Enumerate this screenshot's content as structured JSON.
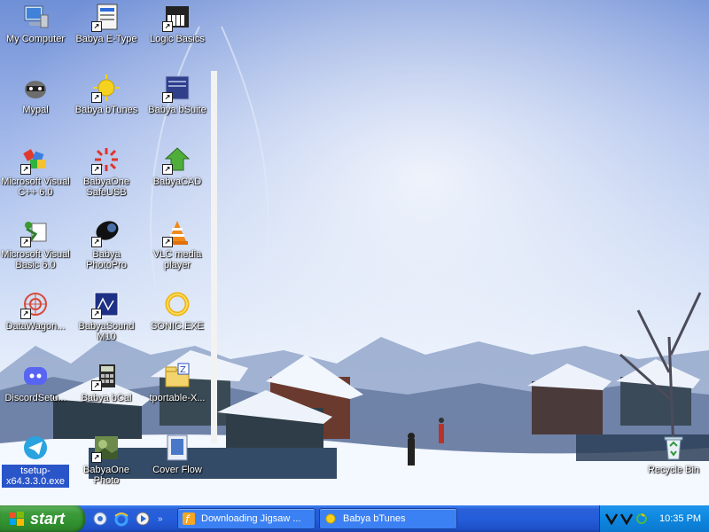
{
  "desktop": {
    "icons": [
      {
        "label": "My Computer"
      },
      {
        "label": "Babya E-Type"
      },
      {
        "label": "Logic Basics"
      },
      {
        "label": "Mypal"
      },
      {
        "label": "Babya bTunes"
      },
      {
        "label": "Babya bSuite"
      },
      {
        "label": "Microsoft Visual C++ 6.0"
      },
      {
        "label": "BabyaOne SafeUSB"
      },
      {
        "label": "BabyaCAD"
      },
      {
        "label": "Microsoft Visual Basic 6.0"
      },
      {
        "label": "Babya PhotoPro"
      },
      {
        "label": "VLC media player"
      },
      {
        "label": "DataWagon..."
      },
      {
        "label": "BabyaSound M10"
      },
      {
        "label": "SONIC.EXE"
      },
      {
        "label": "DiscordSetu..."
      },
      {
        "label": "Babya bCal"
      },
      {
        "label": "tportable-X..."
      },
      {
        "label": "tsetup-x64.3.3.0.exe"
      },
      {
        "label": "BabyaOne Photo"
      },
      {
        "label": "Cover Flow"
      },
      {
        "label": "Recycle Bin"
      }
    ]
  },
  "taskbar": {
    "start_label": "start",
    "tasks": [
      {
        "label": "Downloading Jigsaw ..."
      },
      {
        "label": "Babya bTunes"
      }
    ],
    "clock": "10:35 PM"
  },
  "colors": {
    "taskbar_blue": "#245edb",
    "start_green": "#3c9a3a",
    "tray_blue": "#0f8ae2",
    "selection_blue": "#2a55c9"
  }
}
